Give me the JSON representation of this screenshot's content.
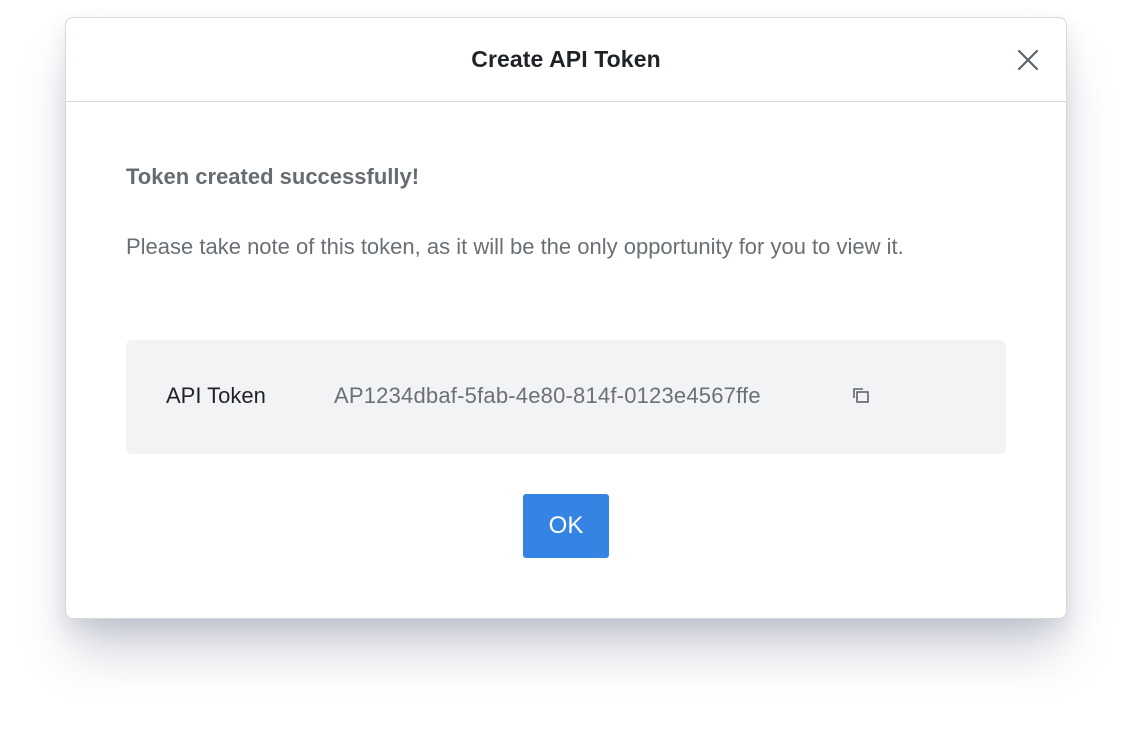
{
  "dialog": {
    "title": "Create API Token",
    "close_icon": "close-icon"
  },
  "body": {
    "success_heading": "Token created successfully!",
    "note": "Please take note of this token, as it will be the only opportunity for you to view it.",
    "token": {
      "label": "API Token",
      "value": "AP1234dbaf-5fab-4e80-814f-0123e4567ffe",
      "copy_icon": "copy-icon"
    },
    "ok_label": "OK"
  },
  "colors": {
    "accent": "#3584e4",
    "token_box_bg": "#f2f3f5",
    "title_text": "#1f2328",
    "muted_text": "#6a6f76"
  }
}
